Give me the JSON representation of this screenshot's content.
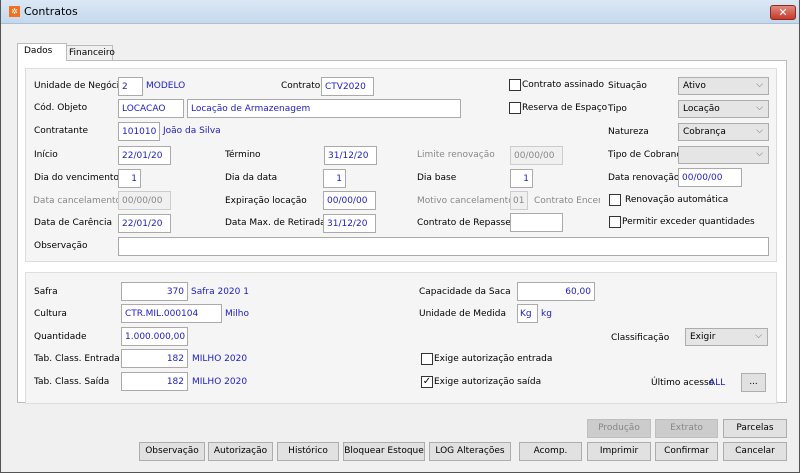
{
  "window": {
    "title": "Contratos",
    "close": "✕"
  },
  "tabs": [
    "Dados",
    "Financeiro"
  ],
  "dados": {
    "unidade_label": "Unidade de Negócio",
    "unidade_value": "2",
    "unidade_desc": "MODELO",
    "contrato_label": "Contrato",
    "contrato_value": "CTV2020",
    "contrato_assinado": {
      "label": "Contrato assinado",
      "checked": false
    },
    "situacao_label": "Situação",
    "situacao_value": "Ativo",
    "objeto_label": "Cód. Objeto",
    "objeto_value": "LOCACAO",
    "objeto_desc": "Locação de Armazenagem",
    "reserva": {
      "label": "Reserva de Espaço",
      "checked": false
    },
    "tipo_label": "Tipo",
    "tipo_value": "Locação",
    "contratante_label": "Contratante",
    "contratante_value": "101010",
    "contratante_desc": "João da Silva",
    "natureza_label": "Natureza",
    "natureza_value": "Cobrança",
    "inicio_label": "Início",
    "inicio_value": "22/01/20",
    "termino_label": "Término",
    "termino_value": "31/12/20",
    "limite_label": "Limite renovação",
    "limite_value": "00/00/00",
    "tipo_cobranca_label": "Tipo de Cobrança",
    "tipo_cobranca_value": "",
    "dia_venc_label": "Dia do vencimento",
    "dia_venc_value": "1",
    "dia_data_label": "Dia da data",
    "dia_data_value": "1",
    "dia_base_label": "Dia base",
    "dia_base_value": "1",
    "data_renov_label": "Data renovação",
    "data_renov_value": "00/00/00",
    "data_cancel_label": "Data cancelamento",
    "data_cancel_value": "00/00/00",
    "expiracao_label": "Expiração locação",
    "expiracao_value": "00/00/00",
    "motivo_label": "Motivo cancelamento",
    "motivo_value": "01",
    "motivo_desc": "Contrato Encerra",
    "renov_auto": {
      "label": "Renovação automática",
      "checked": false
    },
    "carencia_label": "Data de Carência",
    "carencia_value": "22/01/20",
    "max_retirada_label": "Data Max. de Retirada",
    "max_retirada_value": "31/12/20",
    "repasse_label": "Contrato de Repasse",
    "repasse_value": "",
    "exceder": {
      "label": "Permitir exceder quantidades",
      "checked": false
    },
    "obs_label": "Observação",
    "obs_value": ""
  },
  "safra": {
    "safra_label": "Safra",
    "safra_value": "370",
    "safra_desc": "Safra 2020 1",
    "cultura_label": "Cultura",
    "cultura_value": "CTR.MIL.000104",
    "cultura_desc": "Milho",
    "quantidade_label": "Quantidade",
    "quantidade_value": "1.000.000,00",
    "entrada_label": "Tab. Class. Entrada",
    "entrada_value": "182",
    "entrada_desc": "MILHO 2020",
    "saida_label": "Tab. Class. Saída",
    "saida_value": "182",
    "saida_desc": "MILHO 2020",
    "capacidade_label": "Capacidade da Saca",
    "capacidade_value": "60,00",
    "unidade_label": "Unidade de Medida",
    "unidade_value": "Kg",
    "unidade_desc": "kg",
    "classificacao_label": "Classificação",
    "classificacao_value": "Exigir",
    "aut_entrada": {
      "label": "Exige autorização entrada",
      "checked": false
    },
    "aut_saida": {
      "label": "Exige autorização saída",
      "checked": true
    },
    "ultimo_label": "Último acesso",
    "ultimo_value": "ALL",
    "more": "..."
  },
  "buttons": {
    "producao": "Produção",
    "extrato": "Extrato",
    "parcelas": "Parcelas",
    "observacao": "Observação",
    "autorizacao": "Autorização",
    "historico": "Histórico",
    "bloquear": "Bloquear Estoque",
    "log": "LOG Alterações",
    "acomp": "Acomp.",
    "imprimir": "Imprimir",
    "confirmar": "Confirmar",
    "cancelar": "Cancelar"
  },
  "colors": {
    "value_text": "#2020c0",
    "close": "#c7392a"
  }
}
